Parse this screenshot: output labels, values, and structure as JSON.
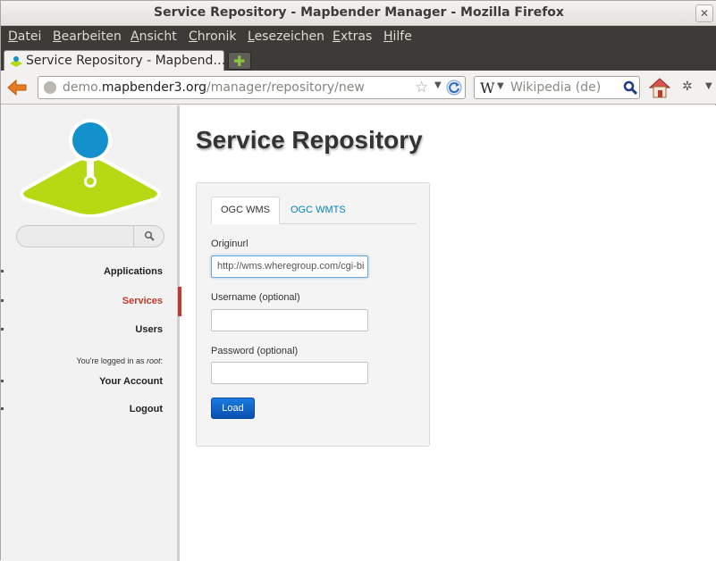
{
  "window": {
    "title": "Service Repository - Mapbender Manager - Mozilla Firefox"
  },
  "menubar": {
    "items": [
      "Datei",
      "Bearbeiten",
      "Ansicht",
      "Chronik",
      "Lesezeichen",
      "Extras",
      "Hilfe"
    ]
  },
  "tabbar": {
    "active_tab": "Service Repository - Mapbend…"
  },
  "navbar": {
    "url_domain_prefix": "demo.",
    "url_domain": "mapbender3.org",
    "url_path": "/manager/repository/new",
    "search_engine_letter": "W",
    "search_placeholder": "Wikipedia (de)"
  },
  "sidebar": {
    "items": [
      {
        "label": "Applications"
      },
      {
        "label": "Services"
      },
      {
        "label": "Users"
      }
    ],
    "logged_prefix": "You're logged in as ",
    "logged_user": "root",
    "logged_suffix": ":",
    "account": "Your Account",
    "logout": "Logout"
  },
  "main": {
    "title": "Service Repository",
    "tabs": [
      "OGC WMS",
      "OGC WMTS"
    ],
    "form": {
      "originurl_label": "Originurl",
      "originurl_value": "http://wms.wheregroup.com/cgi-bi",
      "username_label": "Username (optional)",
      "password_label": "Password (optional)",
      "load_label": "Load"
    }
  },
  "colors": {
    "accent_red": "#c0392b",
    "link_blue": "#0a7fb8",
    "button_blue": "#0a5fc8",
    "logo_green": "#b5d913",
    "logo_blue": "#1391cc"
  }
}
